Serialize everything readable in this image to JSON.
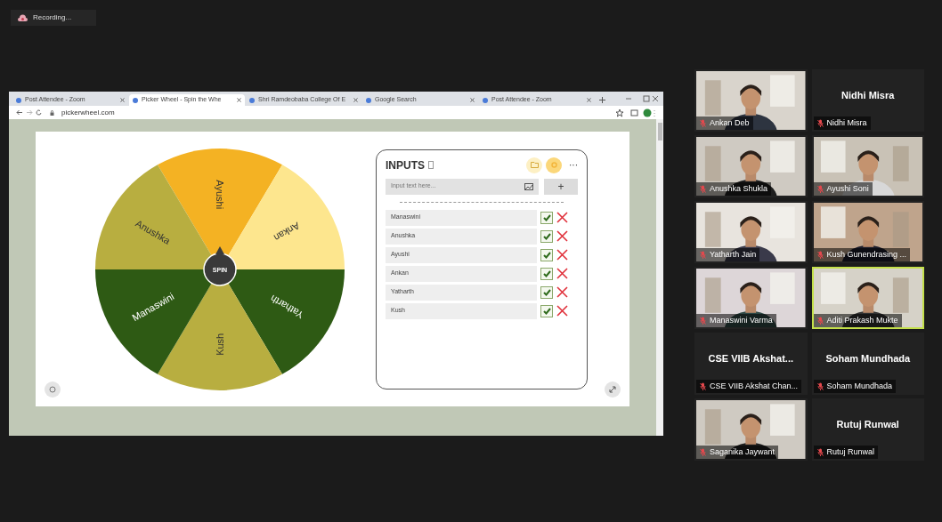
{
  "recording": {
    "label": "Recording..."
  },
  "browser": {
    "tabs": [
      {
        "title": "Post Attendee - Zoom",
        "selected": false
      },
      {
        "title": "Picker Wheel - Spin the Whe",
        "selected": true
      },
      {
        "title": "Shri Ramdeobaba College Of E",
        "selected": false
      },
      {
        "title": "Google Search",
        "selected": false
      },
      {
        "title": "Post Attendee - Zoom",
        "selected": false
      }
    ],
    "url": "pickerwheel.com"
  },
  "wheel": {
    "spin_label": "SPIN",
    "slices": [
      {
        "label": "Ayushi",
        "color": "#f4b223"
      },
      {
        "label": "Ankan",
        "color": "#fde68e"
      },
      {
        "label": "Yatharth",
        "color": "#2e5a14"
      },
      {
        "label": "Kush",
        "color": "#b8ae40"
      },
      {
        "label": "Manaswini",
        "color": "#2e5a14"
      },
      {
        "label": "Anushka",
        "color": "#b8ae40"
      }
    ]
  },
  "inputs": {
    "title": "INPUTS",
    "placeholder": "Input text here...",
    "add_label": "+",
    "more_label": "···",
    "items": [
      {
        "label": "Manaswini",
        "checked": true
      },
      {
        "label": "Anushka",
        "checked": true
      },
      {
        "label": "Ayushi",
        "checked": true
      },
      {
        "label": "Ankan",
        "checked": true
      },
      {
        "label": "Yatharth",
        "checked": true
      },
      {
        "label": "Kush",
        "checked": true
      }
    ]
  },
  "gallery_rows": [
    {
      "tiles": [
        {
          "kind": "video",
          "speaking": false,
          "name": "Ankan Deb"
        },
        {
          "kind": "name",
          "speaking": false,
          "display": "Nidhi Misra",
          "name": "Nidhi Misra"
        }
      ]
    },
    {
      "tiles": [
        {
          "kind": "video",
          "speaking": false,
          "name": "Anushka Shukla"
        },
        {
          "kind": "video",
          "speaking": false,
          "name": "Ayushi Soni"
        }
      ]
    },
    {
      "tiles": [
        {
          "kind": "video",
          "speaking": false,
          "name": "Yatharth Jain"
        },
        {
          "kind": "video",
          "speaking": false,
          "name": "Kush Gunendrasing ..."
        }
      ]
    },
    {
      "tiles": [
        {
          "kind": "video",
          "speaking": false,
          "name": "Manaswini Varma"
        },
        {
          "kind": "video",
          "speaking": true,
          "name": "Aditi Prakash Mukte"
        }
      ]
    },
    {
      "tiles": [
        {
          "kind": "name",
          "speaking": false,
          "display": "CSE VIIB Akshat...",
          "name": "CSE VIIB Akshat Chan..."
        },
        {
          "kind": "name",
          "speaking": false,
          "display": "Soham Mundhada",
          "name": "Soham Mundhada"
        }
      ]
    },
    {
      "tiles": [
        {
          "kind": "video",
          "speaking": false,
          "name": "Saganika Jaywant"
        },
        {
          "kind": "name",
          "speaking": false,
          "display": "Rutuj Runwal",
          "name": "Rutuj Runwal"
        }
      ]
    }
  ]
}
